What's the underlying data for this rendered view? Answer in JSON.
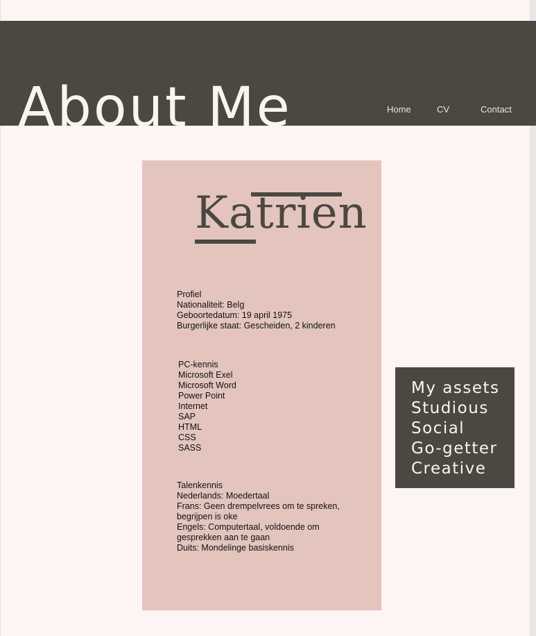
{
  "header": {
    "title": "About Me",
    "nav": {
      "home": "Home",
      "cv": "CV",
      "contact": "Contact"
    }
  },
  "card": {
    "name": "Katrien",
    "profile": [
      "Profiel",
      "Nationaliteit: Belg",
      "Geboortedatum: 19 april 1975",
      "Burgerlijke staat: Gescheiden, 2 kinderen"
    ],
    "pc_skills": [
      "PC-kennis",
      "Microsoft Exel",
      "Microsoft Word",
      "Power Point",
      "Internet",
      "SAP",
      "HTML",
      "CSS",
      "SASS"
    ],
    "languages": [
      "Talenkennis",
      "Nederlands: Moedertaal",
      "Frans: Geen drempelvrees om te spreken, begrijpen is oke",
      "Engels: Computertaal, voldoende om gesprekken aan te gaan",
      "Duits: Mondelinge basiskennis"
    ]
  },
  "assets": [
    "My assets",
    "Studious",
    "Social",
    "Go-getter",
    "Creative"
  ],
  "colors": {
    "background": "#fdf5f3",
    "header": "#4a4840",
    "card": "#e3c5be",
    "accent_text": "#fbf3ef"
  }
}
